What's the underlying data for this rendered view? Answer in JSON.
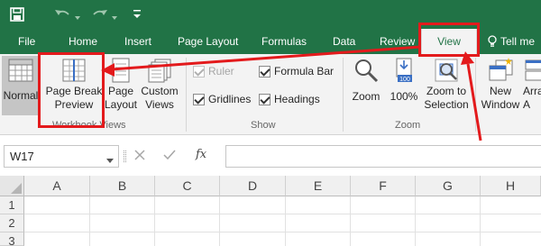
{
  "tabs": [
    {
      "key": "file",
      "label": "File"
    },
    {
      "key": "home",
      "label": "Home"
    },
    {
      "key": "insert",
      "label": "Insert"
    },
    {
      "key": "page_layout",
      "label": "Page Layout"
    },
    {
      "key": "formulas",
      "label": "Formulas"
    },
    {
      "key": "data",
      "label": "Data"
    },
    {
      "key": "review",
      "label": "Review"
    },
    {
      "key": "view",
      "label": "View",
      "active": true
    }
  ],
  "tell_me": "Tell me",
  "ribbon": {
    "normal_label": "Normal",
    "page_break_label_1": "Page Break",
    "page_break_label_2": "Preview",
    "page_layout_label_1": "Page",
    "page_layout_label_2": "Layout",
    "custom_views_label_1": "Custom",
    "custom_views_label_2": "Views",
    "workbook_views_group": "Workbook Views",
    "ruler_label": "Ruler",
    "gridlines_label": "Gridlines",
    "formula_bar_label": "Formula Bar",
    "headings_label": "Headings",
    "show_group": "Show",
    "zoom_label": "Zoom",
    "zoom100_label": "100%",
    "zoom100_badge": "100",
    "zoom_sel_label_1": "Zoom to",
    "zoom_sel_label_2": "Selection",
    "zoom_group": "Zoom",
    "new_window_label_1": "New",
    "new_window_label_2": "Window",
    "arrange_label_1": "Arra",
    "arrange_label_2": "A"
  },
  "formula_bar": {
    "name_box": "W17",
    "fx": "fx",
    "value": ""
  },
  "columns": [
    "A",
    "B",
    "C",
    "D",
    "E",
    "F",
    "G",
    "H"
  ],
  "rows": [
    "1",
    "2",
    "3"
  ],
  "colors": {
    "excel_green": "#217346",
    "annotation_red": "#e31a1c"
  }
}
